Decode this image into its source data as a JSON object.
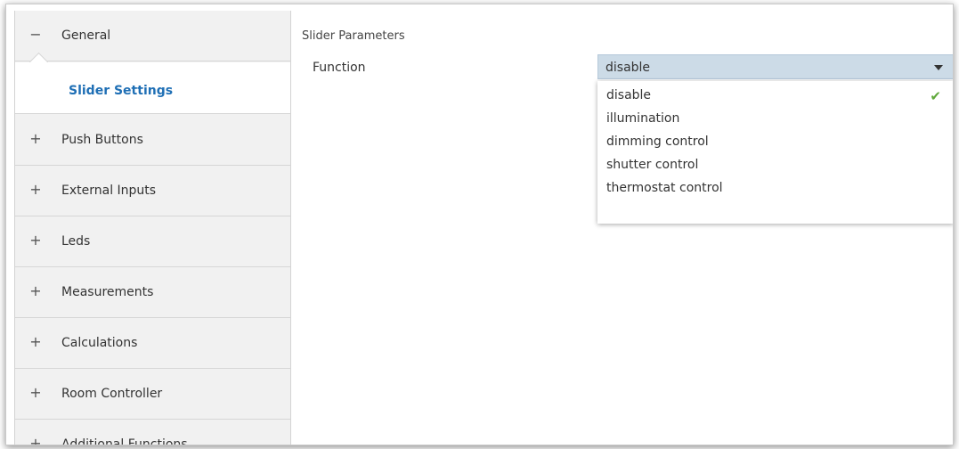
{
  "sidebar": {
    "general": {
      "symbol": "−",
      "label": "General"
    },
    "subitem": {
      "label": "Slider Settings"
    },
    "items": [
      {
        "symbol": "+",
        "label": "Push Buttons"
      },
      {
        "symbol": "+",
        "label": "External Inputs"
      },
      {
        "symbol": "+",
        "label": "Leds"
      },
      {
        "symbol": "+",
        "label": "Measurements"
      },
      {
        "symbol": "+",
        "label": "Calculations"
      },
      {
        "symbol": "+",
        "label": "Room Controller"
      },
      {
        "symbol": "+",
        "label": "Additional Functions"
      }
    ]
  },
  "main": {
    "section_title": "Slider Parameters",
    "function_label": "Function",
    "function_value": "disable",
    "options": [
      {
        "label": "disable",
        "selected": true
      },
      {
        "label": "illumination"
      },
      {
        "label": "dimming control"
      },
      {
        "label": "shutter control"
      },
      {
        "label": "thermostat control"
      }
    ],
    "check_glyph": "✔"
  },
  "colors": {
    "accent": "#1f6fb5",
    "combo_bg": "#ccdbe7",
    "check": "#5fa83a",
    "sidebar_bg": "#f1f1f1"
  }
}
